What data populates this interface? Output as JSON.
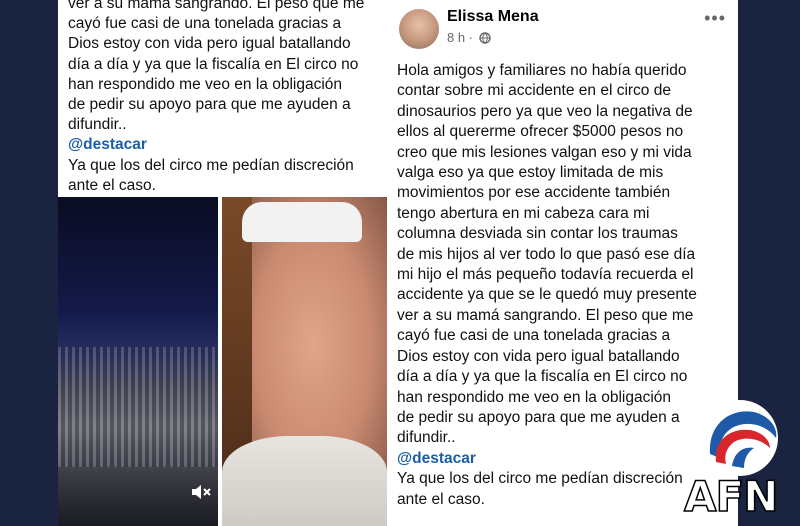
{
  "left_post": {
    "lines": [
      "ver a su mamá sangrando. El peso que me",
      "cayó fue casi de una tonelada gracias a",
      "Dios estoy con vida pero igual batallando",
      "día a día y ya que la fiscalía en El circo no",
      "han respondido me veo en  la obligación",
      " de pedir su apoyo para que me ayuden a",
      "difundir.."
    ],
    "mention": "@destacar",
    "closing_lines": [
      "Ya que los del circo me pedían discreción",
      "ante el caso."
    ]
  },
  "right_post": {
    "author": "Elissa Mena",
    "time": "8 h ·",
    "more": "•••",
    "lines": [
      "Hola amigos y familiares no había querido",
      "contar sobre mi accidente en el circo de",
      "dinosaurios pero ya que veo la negativa de",
      "ellos al quererme ofrecer $5000 pesos no",
      "creo que mis lesiones valgan eso y mi vida",
      "valga eso    ya que estoy limitada de mis",
      "movimientos por ese accidente también",
      "tengo abertura en mi cabeza cara mi",
      "columna desviada sin contar los traumas",
      "de mis hijos al ver todo lo que pasó ese día",
      "mi hijo el más pequeño todavía recuerda el",
      "accidente ya que se le quedó muy presente",
      "ver a su mamá sangrando. El peso que me",
      "cayó fue casi de una tonelada gracias a",
      "Dios estoy con vida pero igual batallando",
      "día a día y ya que la fiscalía en El circo no",
      "han respondido me veo en  la obligación",
      " de pedir su apoyo para que me ayuden a",
      "difundir.."
    ],
    "mention": "@destacar",
    "closing_lines": [
      "Ya que los del circo me pedían discreción",
      "ante el caso."
    ]
  },
  "watermark": {
    "text": "AFN"
  },
  "colors": {
    "mention": "#1c5fa8",
    "background": "#1a2340"
  },
  "icons": [
    "speaker-mute-icon",
    "globe-icon",
    "more-options-icon"
  ]
}
